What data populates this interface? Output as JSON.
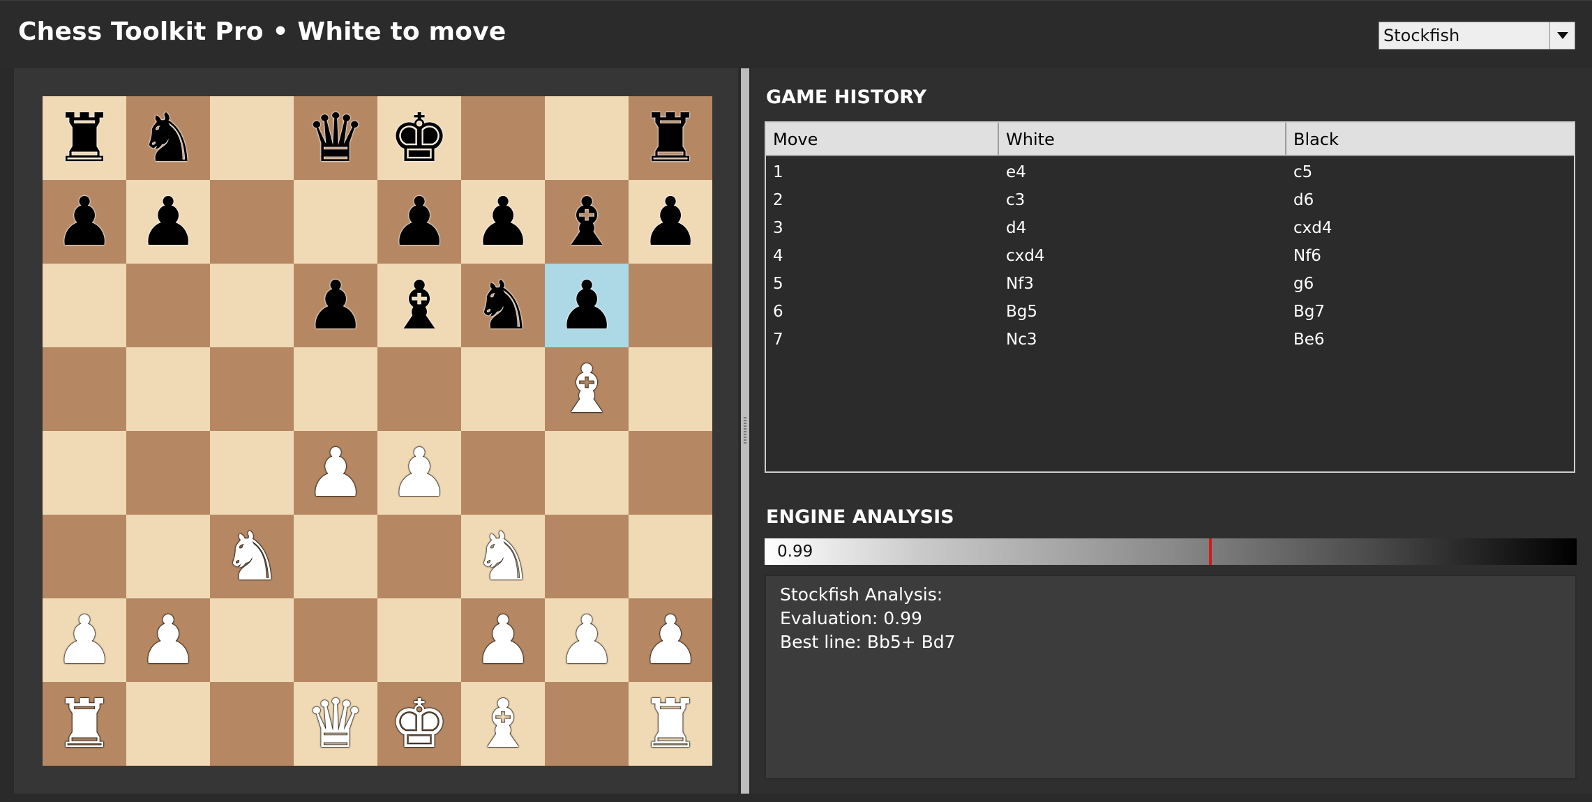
{
  "app": {
    "title": "Chess Toolkit Pro • White to move"
  },
  "engine_select": {
    "value": "Stockfish"
  },
  "board": {
    "highlight_square": "g6",
    "colors": {
      "light": "#f0d9b5",
      "dark": "#b58863",
      "highlight": "#add8e6"
    },
    "ranks": [
      [
        "bR",
        "bN",
        "",
        "bQ",
        "bK",
        "",
        "",
        "bR"
      ],
      [
        "bP",
        "bP",
        "",
        "",
        "bP",
        "bP",
        "bB",
        "bP"
      ],
      [
        "",
        "",
        "",
        "bP",
        "bB",
        "bN",
        "bP",
        ""
      ],
      [
        "",
        "",
        "",
        "",
        "",
        "",
        "wB",
        ""
      ],
      [
        "",
        "",
        "",
        "wP",
        "wP",
        "",
        "",
        ""
      ],
      [
        "",
        "",
        "wN",
        "",
        "",
        "wN",
        "",
        ""
      ],
      [
        "wP",
        "wP",
        "",
        "",
        "",
        "wP",
        "wP",
        "wP"
      ],
      [
        "wR",
        "",
        "",
        "wQ",
        "wK",
        "wB",
        "",
        "wR"
      ]
    ]
  },
  "history": {
    "title": "GAME HISTORY",
    "columns": [
      "Move",
      "White",
      "Black"
    ],
    "rows": [
      [
        "1",
        "e4",
        "c5"
      ],
      [
        "2",
        "c3",
        "d6"
      ],
      [
        "3",
        "d4",
        "cxd4"
      ],
      [
        "4",
        "cxd4",
        "Nf6"
      ],
      [
        "5",
        "Nf3",
        "g6"
      ],
      [
        "6",
        "Bg5",
        "Bg7"
      ],
      [
        "7",
        "Nc3",
        "Be6"
      ]
    ]
  },
  "analysis": {
    "title": "ENGINE ANALYSIS",
    "eval_value": "0.99",
    "eval_marker_color": "#d41b1b",
    "lines": [
      "Stockfish Analysis:",
      "Evaluation: 0.99",
      "Best line: Bb5+ Bd7"
    ]
  }
}
